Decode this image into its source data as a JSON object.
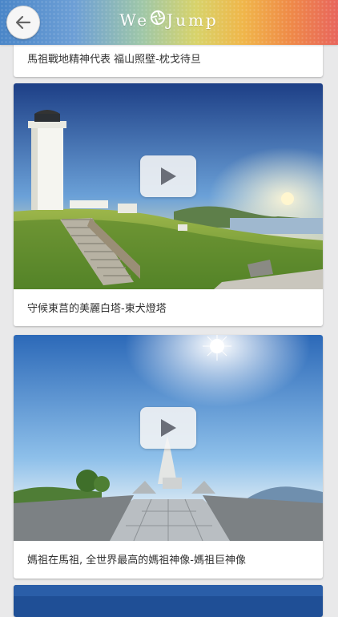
{
  "header": {
    "brand_left": "We",
    "brand_right": "Jump",
    "back_icon": "arrow-left-icon",
    "logo_icon": "aperture-icon"
  },
  "videos": [
    {
      "title": "馬祖戰地精神代表 福山照壁-枕戈待旦"
    },
    {
      "title": "守候東莒的美麗白塔-東犬燈塔"
    },
    {
      "title": "媽祖在馬祖, 全世界最高的媽祖神像-媽祖巨神像"
    }
  ],
  "colors": {
    "background": "#e9e9ea",
    "card": "#ffffff",
    "text": "#333333"
  }
}
